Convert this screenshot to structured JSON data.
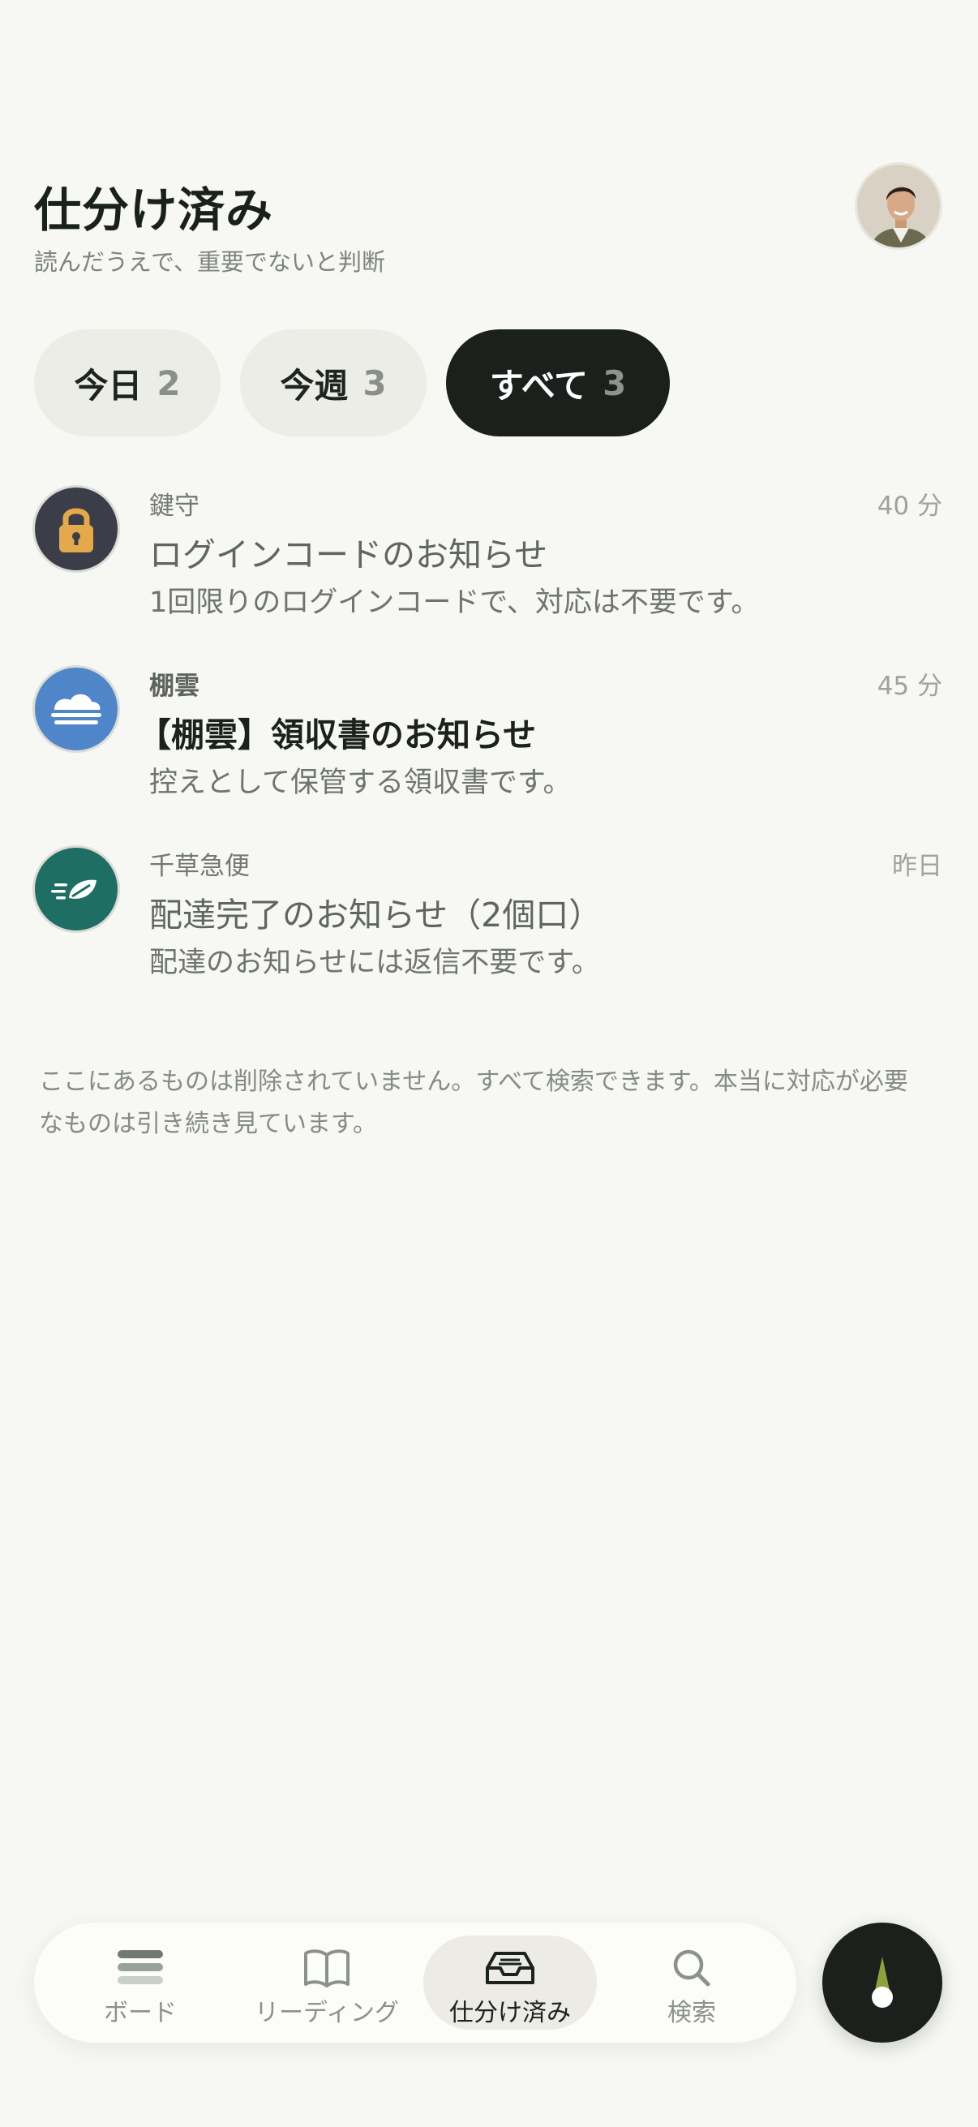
{
  "header": {
    "title": "仕分け済み",
    "subtitle": "読んだうえで、重要でないと判断"
  },
  "filters": [
    {
      "label": "今日",
      "count": "2",
      "active": false
    },
    {
      "label": "今週",
      "count": "3",
      "active": false
    },
    {
      "label": "すべて",
      "count": "3",
      "active": true
    }
  ],
  "items": [
    {
      "sender": "鍵守",
      "time": "40 分",
      "subject": "ログインコードのお知らせ",
      "preview": "1回限りのログインコードで、対応は不要です。",
      "icon": "lock-icon",
      "unread": false
    },
    {
      "sender": "棚雲",
      "time": "45 分",
      "subject": "【棚雲】領収書のお知らせ",
      "preview": "控えとして保管する領収書です。",
      "icon": "cloud-icon",
      "unread": true
    },
    {
      "sender": "千草急便",
      "time": "昨日",
      "subject": "配達完了のお知らせ（2個口）",
      "preview": "配達のお知らせには返信不要です。",
      "icon": "leaf-icon",
      "unread": false
    }
  ],
  "note": "ここにあるものは削除されていません。すべて検索できます。本当に対応が必要なものは引き続き見ています。",
  "nav": [
    {
      "label": "ボード",
      "icon": "board-icon",
      "active": false
    },
    {
      "label": "リーディング",
      "icon": "book-icon",
      "active": false
    },
    {
      "label": "仕分け済み",
      "icon": "inbox-tray-icon",
      "active": true
    },
    {
      "label": "検索",
      "icon": "search-icon",
      "active": false
    }
  ],
  "colors": {
    "background": "#f7f7f3",
    "active_pill": "#1b201d",
    "inactive_pill": "#ecede6",
    "lock_bg": "#3b3d48",
    "lock_accent": "#e3a94a",
    "cloud_bg": "#4f86c9",
    "leaf_bg": "#1e6e63",
    "compass_accent": "#8fa23a"
  }
}
